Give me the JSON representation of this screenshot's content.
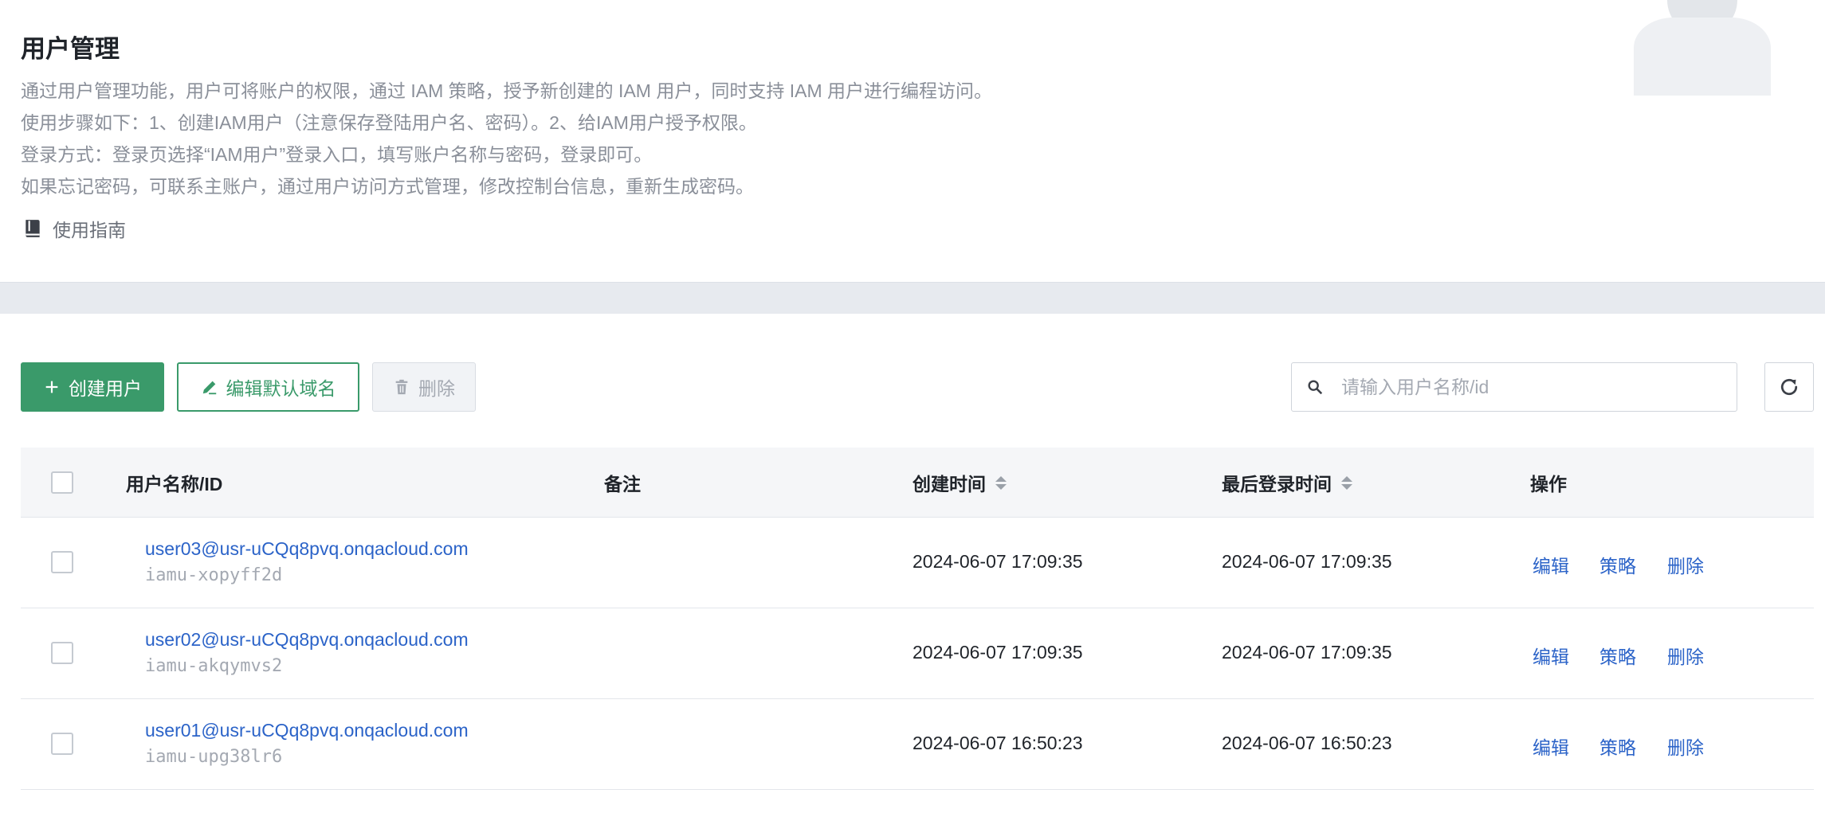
{
  "header": {
    "title": "用户管理",
    "description": [
      "通过用户管理功能，用户可将账户的权限，通过 IAM 策略，授予新创建的 IAM 用户，同时支持 IAM 用户进行编程访问。",
      "使用步骤如下：1、创建IAM用户（注意保存登陆用户名、密码）。2、给IAM用户授予权限。",
      "登录方式：登录页选择“IAM用户”登录入口，填写账户名称与密码，登录即可。",
      "如果忘记密码，可联系主账户，通过用户访问方式管理，修改控制台信息，重新生成密码。"
    ],
    "guide_label": "使用指南"
  },
  "toolbar": {
    "create_label": "创建用户",
    "edit_domain_label": "编辑默认域名",
    "delete_label": "删除",
    "search_placeholder": "请输入用户名称/id"
  },
  "table": {
    "columns": {
      "name": "用户名称/ID",
      "remark": "备注",
      "created": "创建时间",
      "last_login": "最后登录时间",
      "actions": "操作"
    },
    "rows": [
      {
        "name": "user03@usr-uCQq8pvq.onqacloud.com",
        "id": "iamu-xopyff2d",
        "remark": "",
        "created": "2024-06-07 17:09:35",
        "last_login": "2024-06-07 17:09:35"
      },
      {
        "name": "user02@usr-uCQq8pvq.onqacloud.com",
        "id": "iamu-akqymvs2",
        "remark": "",
        "created": "2024-06-07 17:09:35",
        "last_login": "2024-06-07 17:09:35"
      },
      {
        "name": "user01@usr-uCQq8pvq.onqacloud.com",
        "id": "iamu-upg38lr6",
        "remark": "",
        "created": "2024-06-07 16:50:23",
        "last_login": "2024-06-07 16:50:23"
      }
    ],
    "actions": {
      "edit": "编辑",
      "policy": "策略",
      "delete": "删除"
    }
  },
  "colors": {
    "primary": "#3a9a6a",
    "link": "#2b63c8",
    "muted_text": "#8a8f99",
    "band": "#e7eaef"
  },
  "icons": {
    "guide": "book-icon",
    "create": "plus-icon",
    "edit_domain": "pencil-icon",
    "delete": "trash-icon",
    "search": "search-icon",
    "refresh": "refresh-icon"
  }
}
